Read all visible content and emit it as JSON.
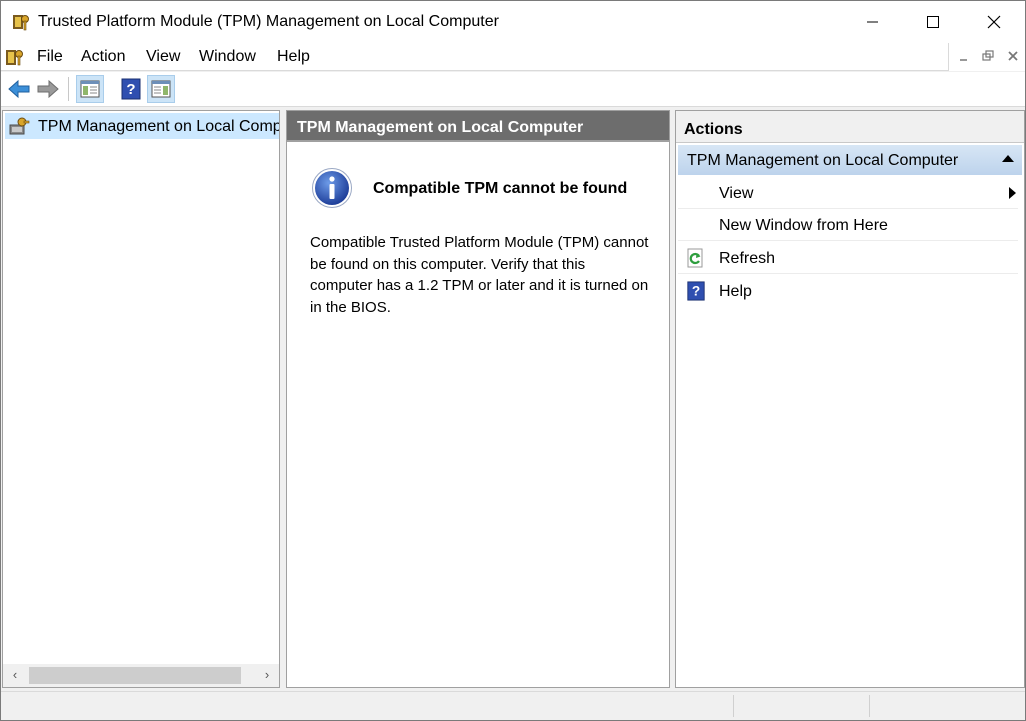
{
  "window": {
    "title": "Trusted Platform Module (TPM) Management on Local Computer",
    "icon": "tpm-key-icon"
  },
  "menu": {
    "items": [
      "File",
      "Action",
      "View",
      "Window",
      "Help"
    ]
  },
  "toolbar": {
    "buttons": [
      "back-arrow-icon",
      "forward-arrow-icon",
      "show-hide-console-tree-icon",
      "help-icon",
      "show-hide-action-pane-icon"
    ]
  },
  "tree": {
    "root_label": "TPM Management on Local Computer"
  },
  "center": {
    "header": "TPM Management on Local Computer",
    "info_title": "Compatible TPM cannot be found",
    "info_body": "Compatible Trusted Platform Module (TPM) cannot be found on this computer. Verify that this computer has a 1.2 TPM or later and it is turned on in the BIOS."
  },
  "actions": {
    "header": "Actions",
    "group_label": "TPM Management on Local Computer",
    "items": [
      {
        "label": "View",
        "icon": "",
        "submenu": true
      },
      {
        "label": "New Window from Here",
        "icon": "",
        "submenu": false
      },
      {
        "label": "Refresh",
        "icon": "refresh-icon",
        "submenu": false
      },
      {
        "label": "Help",
        "icon": "help-icon",
        "submenu": false
      }
    ]
  },
  "colors": {
    "selection": "#cce8ff",
    "center_header_bg": "#6d6d6d",
    "actions_group_bg": "#c6daf0"
  }
}
